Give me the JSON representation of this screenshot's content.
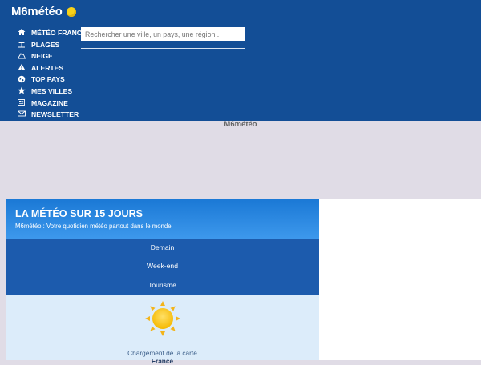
{
  "header": {
    "logo_text": "M6météo",
    "search": {
      "placeholder": "Rechercher une ville, un pays, une région..."
    }
  },
  "nav": {
    "items": [
      {
        "label": "MÉTÉO FRANCE",
        "icon": "home-icon"
      },
      {
        "label": "PLAGES",
        "icon": "umbrella-icon"
      },
      {
        "label": "NEIGE",
        "icon": "mountain-icon"
      },
      {
        "label": "ALERTES",
        "icon": "warning-icon"
      },
      {
        "label": "TOP PAYS",
        "icon": "globe-icon"
      },
      {
        "label": "MES VILLES",
        "icon": "star-icon"
      },
      {
        "label": "MAGAZINE",
        "icon": "newspaper-icon"
      },
      {
        "label": "NEWSLETTER",
        "icon": "mail-icon"
      }
    ]
  },
  "ad_logo_text": "M6météo",
  "main": {
    "banner_title": "LA MÉTÉO SUR 15 JOURS",
    "banner_subtitle": "M6météo : Votre quotidien météo partout dans le monde",
    "menu": [
      "Demain",
      "Week-end",
      "Tourisme"
    ],
    "loading_text": "Chargement de la carte",
    "loading_sub": "France"
  },
  "colors": {
    "header_bg": "#134e96",
    "accent_yellow": "#f7d21a",
    "banner_blue": "#2a88e0"
  }
}
